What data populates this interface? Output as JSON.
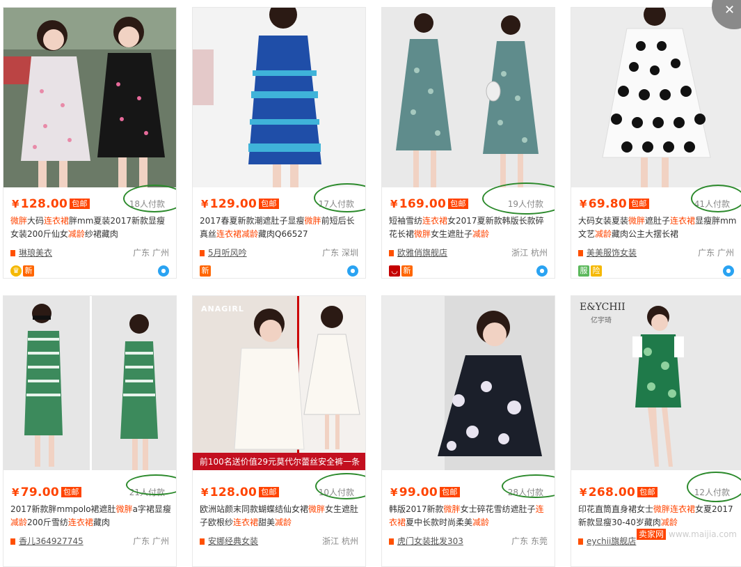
{
  "currency_symbol": "¥",
  "free_shipping_label": "包邮",
  "close_glyph": "✕",
  "watermark": {
    "brand": "卖家网",
    "domain": "www.maijia.com"
  },
  "products": [
    {
      "price": "128.00",
      "paid": "18人付款",
      "title_parts": [
        {
          "t": "微胖",
          "h": true
        },
        {
          "t": "大码",
          "h": false
        },
        {
          "t": "连衣裙",
          "h": true
        },
        {
          "t": "胖mm夏装2017新款显瘦女装200斤仙女",
          "h": false
        },
        {
          "t": "减龄",
          "h": true
        },
        {
          "t": "纱裙藏肉",
          "h": false
        }
      ],
      "shop": "琳琅美衣",
      "location": "广东 广州",
      "icons": [
        "gold-crown-icon",
        "新"
      ],
      "wangwang": true
    },
    {
      "price": "129.00",
      "paid": "17人付款",
      "title_parts": [
        {
          "t": "2017春夏新款潮遮肚子显瘦",
          "h": false
        },
        {
          "t": "微胖",
          "h": true
        },
        {
          "t": "前短后长真丝",
          "h": false
        },
        {
          "t": "连衣裙减龄",
          "h": true
        },
        {
          "t": "藏肉Q66527",
          "h": false
        }
      ],
      "shop": "5月听风吟",
      "location": "广东 深圳",
      "icons": [
        "新"
      ],
      "wangwang": true
    },
    {
      "price": "169.00",
      "paid": "19人付款",
      "title_parts": [
        {
          "t": "短袖雪纺",
          "h": false
        },
        {
          "t": "连衣裙",
          "h": true
        },
        {
          "t": "女2017夏新款韩版长款碎花长裙",
          "h": false
        },
        {
          "t": "微胖",
          "h": true
        },
        {
          "t": "女生遮肚子",
          "h": false
        },
        {
          "t": "减龄",
          "h": true
        }
      ],
      "shop": "欧雅俏旗舰店",
      "location": "浙江 杭州",
      "icons": [
        "tmall-icon",
        "新"
      ],
      "wangwang": true
    },
    {
      "price": "69.80",
      "paid": "41人付款",
      "title_parts": [
        {
          "t": "大码女装夏装",
          "h": false
        },
        {
          "t": "微胖",
          "h": true
        },
        {
          "t": "遮肚子",
          "h": false
        },
        {
          "t": "连衣裙",
          "h": true
        },
        {
          "t": "显瘦胖mm文艺",
          "h": false
        },
        {
          "t": "减龄",
          "h": true
        },
        {
          "t": "藏肉公主大摆长裙",
          "h": false
        }
      ],
      "shop": "美美服饰女装",
      "location": "广东 广州",
      "icons": [
        "服",
        "险"
      ],
      "wangwang": true
    },
    {
      "price": "79.00",
      "paid": "21人付款",
      "title_parts": [
        {
          "t": "2017新款胖mmpolo裙遮肚",
          "h": false
        },
        {
          "t": "微胖",
          "h": true
        },
        {
          "t": "a字裙显瘦",
          "h": false
        },
        {
          "t": "减龄",
          "h": true
        },
        {
          "t": "200斤雪纺",
          "h": false
        },
        {
          "t": "连衣裙",
          "h": true
        },
        {
          "t": "藏肉",
          "h": false
        }
      ],
      "shop": "香儿364927745",
      "location": "广东 广州",
      "icons": [],
      "wangwang": false
    },
    {
      "price": "128.00",
      "paid": "10人付款",
      "title_parts": [
        {
          "t": "欧洲站颜末同款蝴蝶结仙女裙",
          "h": false
        },
        {
          "t": "微胖",
          "h": true
        },
        {
          "t": "女生遮肚子欧根纱",
          "h": false
        },
        {
          "t": "连衣裙",
          "h": true
        },
        {
          "t": "甜美",
          "h": false
        },
        {
          "t": "减龄",
          "h": true
        }
      ],
      "shop": "安娜经典女装",
      "location": "浙江 杭州",
      "icons": [],
      "wangwang": false
    },
    {
      "price": "99.00",
      "paid": "28人付款",
      "title_parts": [
        {
          "t": "韩版2017新款",
          "h": false
        },
        {
          "t": "微胖",
          "h": true
        },
        {
          "t": "女士碎花雪纺遮肚子",
          "h": false
        },
        {
          "t": "连衣裙",
          "h": true
        },
        {
          "t": "夏中长款时尚柔美",
          "h": false
        },
        {
          "t": "减龄",
          "h": true
        }
      ],
      "shop": "虎门女装批发303",
      "location": "广东 东莞",
      "icons": [],
      "wangwang": false
    },
    {
      "price": "268.00",
      "paid": "12人付款",
      "title_parts": [
        {
          "t": "印花直筒直身裙女士",
          "h": false
        },
        {
          "t": "微胖",
          "h": true
        },
        {
          "t": "连衣裙",
          "h": true
        },
        {
          "t": "女夏2017新款显瘦30-40岁藏肉",
          "h": false
        },
        {
          "t": "减龄",
          "h": true
        }
      ],
      "shop": "eychii旗舰店",
      "location": "",
      "icons": [],
      "wangwang": false
    }
  ],
  "banners": {
    "anagirl_logo": "ANAGIRL",
    "anagirl_promo": "前100名送价值29元莫代尔蕾丝安全裤一条",
    "eychii_logo": "E&YCHII",
    "eychii_sub": "亿宇琦"
  },
  "colors": {
    "accent": "#ff4400",
    "annotation": "#2c8a2c",
    "wangwang": "#2aa3f2"
  }
}
